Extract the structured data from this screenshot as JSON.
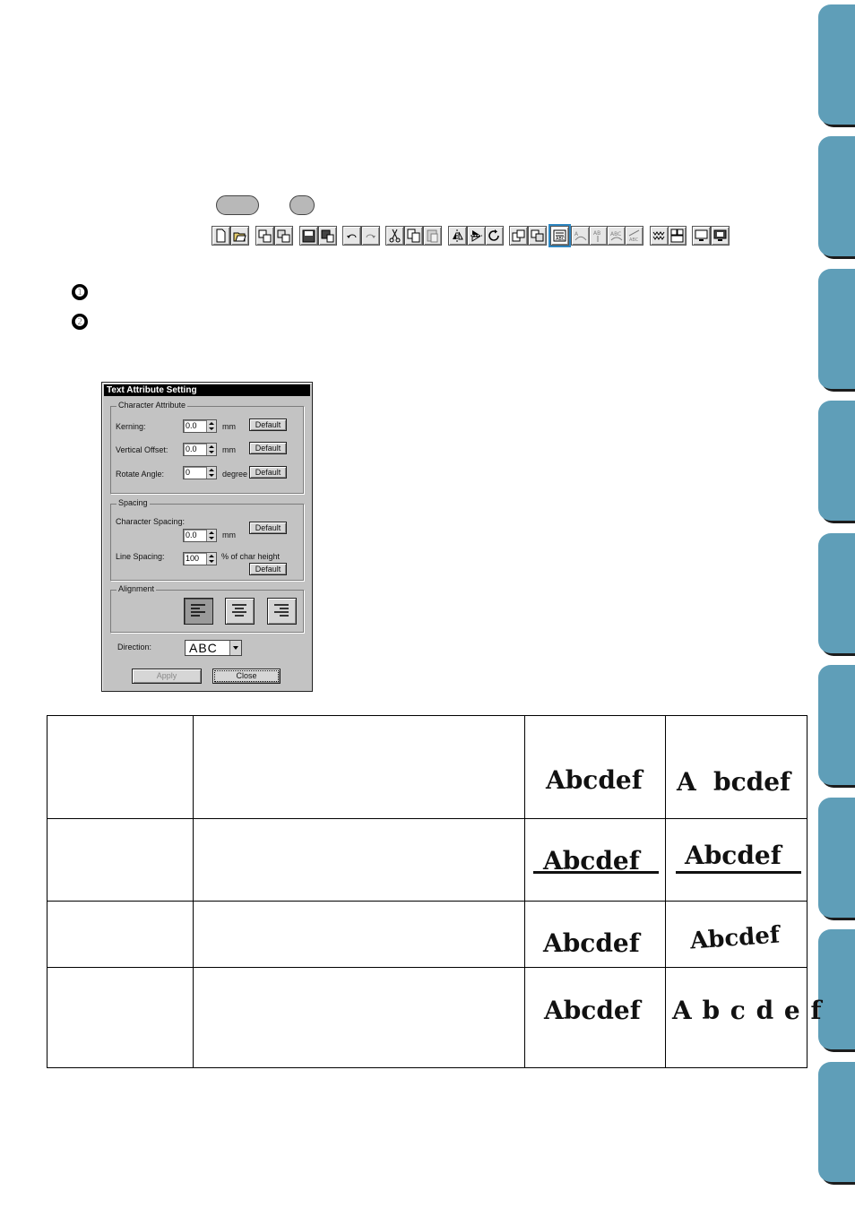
{
  "side_tabs": [
    "tab-1",
    "tab-2",
    "tab-3",
    "tab-4",
    "tab-5",
    "tab-6",
    "tab-7",
    "tab-8",
    "tab-9"
  ],
  "toolbar": {
    "icons": [
      "new-file-icon",
      "open-file-icon",
      "import-icon",
      "export-icon",
      "save-icon",
      "save-as-icon",
      "undo-icon",
      "redo-icon",
      "cut-icon",
      "copy-icon",
      "paste-icon",
      "mirror-horizontal-icon",
      "mirror-vertical-icon",
      "rotate-icon",
      "group-icon",
      "ungroup-icon",
      "text-attribute-icon",
      "text-fit-path-icon",
      "text-vertical-icon",
      "text-arc-icon",
      "text-transform-icon",
      "stitch-icon",
      "layout-icon",
      "preview-icon",
      "realistic-preview-icon"
    ]
  },
  "bullets": [
    "➊",
    "➋"
  ],
  "dialog": {
    "title": "Text Attribute Setting",
    "character_attribute": {
      "label": "Character Attribute",
      "kerning_label": "Kerning:",
      "kerning_value": "0.0",
      "kerning_unit": "mm",
      "vertical_offset_label": "Vertical Offset:",
      "vertical_offset_value": "0.0",
      "vertical_offset_unit": "mm",
      "rotate_angle_label": "Rotate Angle:",
      "rotate_angle_value": "0",
      "rotate_angle_unit": "degree",
      "default_label": "Default"
    },
    "spacing": {
      "label": "Spacing",
      "char_spacing_label": "Character Spacing:",
      "char_spacing_value": "0.0",
      "char_spacing_unit": "mm",
      "line_spacing_label": "Line Spacing:",
      "line_spacing_value": "100",
      "line_spacing_unit": "% of char height",
      "default_label": "Default"
    },
    "alignment": {
      "label": "Alignment",
      "selected": "left"
    },
    "direction": {
      "label": "Direction:",
      "value": "ABC"
    },
    "apply_label": "Apply",
    "close_label": "Close"
  },
  "samples": {
    "row1": {
      "before": "Abcdef",
      "after_a": "A",
      "after_rest": "bcdef"
    },
    "row2": {
      "before": "Abcdef",
      "after": "Abcdef"
    },
    "row3": {
      "before": "Abcdef",
      "after": "Abcdef"
    },
    "row4": {
      "before": "Abcdef",
      "after": "A b c d e f"
    }
  }
}
